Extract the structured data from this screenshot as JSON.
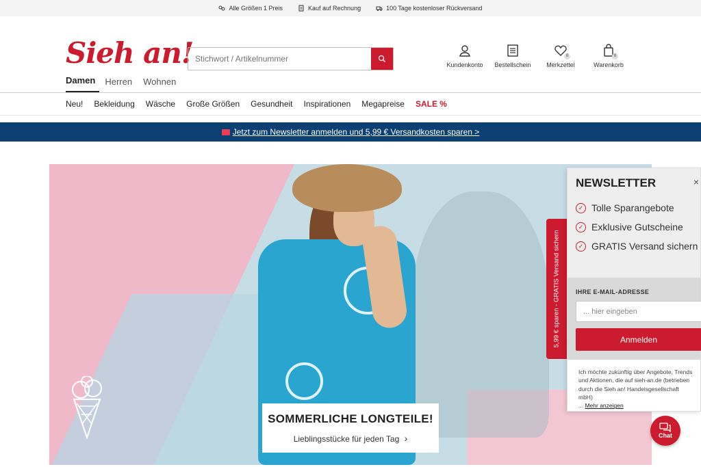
{
  "topbar": {
    "items": [
      {
        "icon": "size-icon",
        "label": "Alle Größen 1 Preis"
      },
      {
        "icon": "invoice-icon",
        "label": "Kauf auf Rechnung"
      },
      {
        "icon": "truck-icon",
        "label": "100 Tage kostenloser Rückversand"
      }
    ]
  },
  "header": {
    "logo": "Sieh an!",
    "search_placeholder": "Stichwort / Artikelnummer",
    "icons": [
      {
        "label": "Kundenkonto",
        "icon": "user-icon"
      },
      {
        "label": "Bestellschein",
        "icon": "list-icon"
      },
      {
        "label": "Merkzettel",
        "icon": "heart-icon",
        "count": "0"
      },
      {
        "label": "Warenkorb",
        "icon": "bag-icon",
        "count": "0"
      }
    ]
  },
  "maintabs": [
    "Damen",
    "Herren",
    "Wohnen"
  ],
  "categories": [
    "Neu!",
    "Bekleidung",
    "Wäsche",
    "Große Größen",
    "Gesundheit",
    "Inspirationen",
    "Megapreise",
    "SALE %"
  ],
  "newsbar": {
    "text": "Jetzt zum Newsletter anmelden und 5,99 € Versandkosten sparen >"
  },
  "hero": {
    "title": "SOMMERLICHE LONGTEILE!",
    "subtitle": "Lieblingsstücke für jeden Tag",
    "chevron": "›"
  },
  "sidetab": {
    "text": "5,99 € sparen - GRATIS Versand sichern"
  },
  "newsletter": {
    "title": "NEWSLETTER",
    "close": "×",
    "benefits": [
      "Tolle Sparangebote",
      "Exklusive Gutscheine",
      "GRATIS Versand sichern"
    ],
    "email_label": "IHRE E-MAIL-ADRESSE",
    "email_placeholder": "... hier eingeben",
    "button": "Anmelden",
    "footer": "Ich möchte zukünftig über Angebote, Trends und Aktionen, die auf sieh-an.de (betrieben durch die Sieh an! Handelsgesellschaft mbH)",
    "footer_prefix": "...",
    "more": "Mehr anzeigen"
  },
  "chat": {
    "label": "Chat"
  },
  "colors": {
    "brand_red": "#cc1b2e",
    "navy": "#0c3f72"
  }
}
